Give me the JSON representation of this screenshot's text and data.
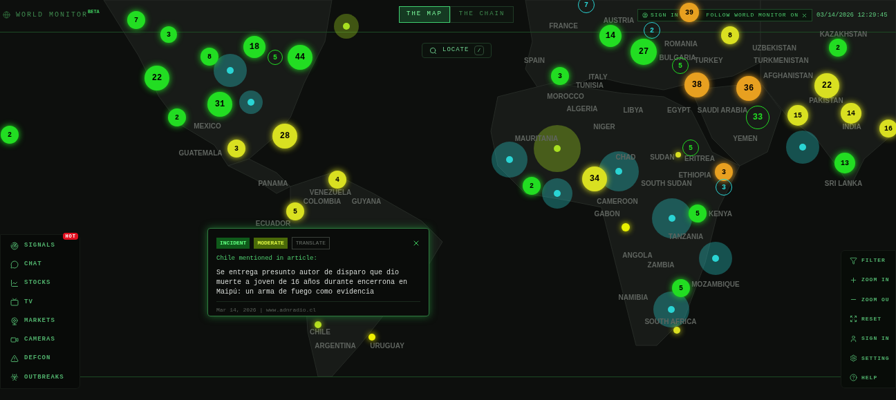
{
  "header": {
    "title": "WORLD MONITOR",
    "badge": "BETA"
  },
  "view_tabs": [
    {
      "label": "THE MAP",
      "selected": true
    },
    {
      "label": "THE CHAIN",
      "selected": false
    }
  ],
  "follow_bar": {
    "sign_in": "SIGN IN",
    "follow": "FOLLOW WORLD MONITOR ON"
  },
  "datetime": "03/14/2026 12:29:45",
  "locate": {
    "label": "LOCATE",
    "shortcut": "/"
  },
  "map_labels": [
    "FRANCE",
    "AUSTRIA",
    "KAZAKHSTAN",
    "ROMANIA",
    "UZBEKISTAN",
    "SPAIN",
    "BULGARIA",
    "TURKEY",
    "TURKMENISTAN",
    "ITALY",
    "AFGHANISTAN",
    "TUNISIA",
    "MOROCCO",
    "PAKISTAN",
    "ALGERIA",
    "LIBYA",
    "EGYPT",
    "SAUDI ARABIA",
    "MEXICO",
    "NIGER",
    "INDIA",
    "MAURITANIA",
    "YEMEN",
    "GUATEMALA",
    "CHAD",
    "SUDAN",
    "ERITREA",
    "ETHIOPIA",
    "PANAMA",
    "SOUTH SUDAN",
    "SRI LANKA",
    "VENEZUELA",
    "COLOMBIA",
    "GUYANA",
    "CAMEROON",
    "GABON",
    "KENYA",
    "ECUADOR",
    "TANZANIA",
    "ANGOLA",
    "ZAMBIA",
    "MOZAMBIQUE",
    "NAMIBIA",
    "SOUTH AFRICA",
    "CHILE",
    "ARGENTINA",
    "URUGUAY"
  ],
  "markers": [
    {
      "kind": "ring",
      "count": "7",
      "color": "#2ad4d4"
    },
    {
      "kind": "cluster",
      "count": "39",
      "color": "#e8a020"
    },
    {
      "kind": "cluster",
      "count": "7",
      "color": "#22dd22"
    },
    {
      "kind": "zone",
      "color": "#a8e020"
    },
    {
      "kind": "ring",
      "count": "2",
      "color": "#2ad4d4"
    },
    {
      "kind": "cluster",
      "count": "3",
      "color": "#22dd22"
    },
    {
      "kind": "cluster",
      "count": "14",
      "color": "#22dd22"
    },
    {
      "kind": "cluster",
      "count": "8",
      "color": "#d9e021"
    },
    {
      "kind": "cluster",
      "count": "18",
      "color": "#22dd22"
    },
    {
      "kind": "cluster",
      "count": "2",
      "color": "#22dd22"
    },
    {
      "kind": "cluster",
      "count": "27",
      "color": "#22dd22"
    },
    {
      "kind": "cluster",
      "count": "8",
      "color": "#22dd22"
    },
    {
      "kind": "ring",
      "count": "5",
      "color": "#22dd22"
    },
    {
      "kind": "cluster",
      "count": "44",
      "color": "#22dd22"
    },
    {
      "kind": "zone",
      "color": "#2ad4d4"
    },
    {
      "kind": "ring",
      "count": "5",
      "color": "#22dd22"
    },
    {
      "kind": "cluster",
      "count": "3",
      "color": "#22dd22"
    },
    {
      "kind": "cluster",
      "count": "22",
      "color": "#22dd22"
    },
    {
      "kind": "cluster",
      "count": "38",
      "color": "#e8a020"
    },
    {
      "kind": "cluster",
      "count": "36",
      "color": "#e8a020"
    },
    {
      "kind": "cluster",
      "count": "22",
      "color": "#d9e021"
    },
    {
      "kind": "cluster",
      "count": "31",
      "color": "#22dd22"
    },
    {
      "kind": "zone",
      "color": "#2ad4d4"
    },
    {
      "kind": "cluster",
      "count": "2",
      "color": "#22dd22"
    },
    {
      "kind": "ring",
      "count": "33",
      "color": "#22dd22"
    },
    {
      "kind": "cluster",
      "count": "15",
      "color": "#d9e021"
    },
    {
      "kind": "cluster",
      "count": "14",
      "color": "#d9e021"
    },
    {
      "kind": "cluster",
      "count": "16",
      "color": "#d9e021"
    },
    {
      "kind": "cluster",
      "count": "2",
      "color": "#22dd22"
    },
    {
      "kind": "cluster",
      "count": "28",
      "color": "#d9e021"
    },
    {
      "kind": "cluster",
      "count": "3",
      "color": "#d9e021"
    },
    {
      "kind": "zone",
      "color": "#a8e020"
    },
    {
      "kind": "ring",
      "count": "5",
      "color": "#22dd22"
    },
    {
      "kind": "zone",
      "color": "#2ad4d4"
    },
    {
      "kind": "point",
      "color": "#d9e021"
    },
    {
      "kind": "zone",
      "color": "#2ad4d4"
    },
    {
      "kind": "cluster",
      "count": "13",
      "color": "#22dd22"
    },
    {
      "kind": "zone",
      "color": "#2ad4d4"
    },
    {
      "kind": "cluster",
      "count": "3",
      "color": "#e8a020"
    },
    {
      "kind": "cluster",
      "count": "4",
      "color": "#d9e021"
    },
    {
      "kind": "cluster",
      "count": "34",
      "color": "#d9e021"
    },
    {
      "kind": "cluster",
      "count": "2",
      "color": "#22dd22"
    },
    {
      "kind": "ring",
      "count": "3",
      "color": "#2ad4d4"
    },
    {
      "kind": "zone",
      "color": "#2ad4d4"
    },
    {
      "kind": "cluster",
      "count": "5",
      "color": "#d9e021"
    },
    {
      "kind": "cluster",
      "count": "5",
      "color": "#22dd22"
    },
    {
      "kind": "zone",
      "color": "#2ad4d4"
    },
    {
      "kind": "point",
      "color": "#e8f000"
    },
    {
      "kind": "zone",
      "color": "#2ad4d4"
    },
    {
      "kind": "cluster",
      "count": "5",
      "color": "#22dd22"
    },
    {
      "kind": "zone",
      "color": "#2ad4d4"
    },
    {
      "kind": "point",
      "color": "#b8e020"
    },
    {
      "kind": "point",
      "color": "#d9e021"
    },
    {
      "kind": "point",
      "color": "#f0f000"
    }
  ],
  "left_menu": [
    {
      "label": "SIGNALS",
      "badge": "HOT"
    },
    {
      "label": "CHAT"
    },
    {
      "label": "STOCKS"
    },
    {
      "label": "TV"
    },
    {
      "label": "MARKETS"
    },
    {
      "label": "CAMERAS"
    },
    {
      "label": "DEFCON"
    },
    {
      "label": "OUTBREAKS"
    }
  ],
  "right_menu": [
    {
      "label": "FILTER"
    },
    {
      "label": "ZOOM IN"
    },
    {
      "label": "ZOOM OU"
    },
    {
      "label": "RESET"
    },
    {
      "label": "SIGN IN"
    },
    {
      "label": "SETTING"
    },
    {
      "label": "HELP"
    }
  ],
  "popup": {
    "tags": [
      {
        "label": "INCIDENT",
        "kind": "type"
      },
      {
        "label": "MODERATE",
        "kind": "severity"
      }
    ],
    "translate": "TRANSLATE",
    "heading": "Chile mentioned in article:",
    "body": "Se entrega presunto autor de disparo que dio muerte a joven de 16 años durante encerrona en Maipú: un arma de fuego como evidencia",
    "meta": "Mar 14, 2026 | www.adnradio.cl"
  }
}
